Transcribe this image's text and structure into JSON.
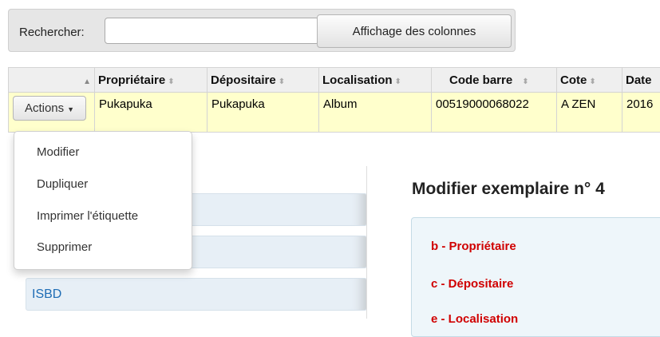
{
  "search": {
    "label": "Rechercher:",
    "value": "",
    "placeholder": ""
  },
  "toolbar": {
    "columns_button": "Affichage des colonnes"
  },
  "table": {
    "headers": [
      "Propriétaire",
      "Dépositaire",
      "Localisation",
      "Code barre",
      "Cote",
      "Date"
    ],
    "row": {
      "actions_label": "Actions",
      "cells": [
        "Pukapuka",
        "Pukapuka",
        "Album",
        "00519000068022",
        "A ZEN",
        "2016"
      ]
    }
  },
  "actions_menu": {
    "items": [
      "Modifier",
      "Dupliquer",
      "Imprimer l'étiquette",
      "Supprimer"
    ]
  },
  "sidebar": {
    "items": [
      {
        "label": ""
      },
      {
        "label": ""
      },
      {
        "label": "ISBD"
      }
    ]
  },
  "main": {
    "title": "Modifier exemplaire n° 4",
    "fields": [
      "b - Propriétaire",
      "c - Dépositaire",
      "e - Localisation"
    ]
  },
  "colors": {
    "field_label": "#d00000",
    "link": "#1e6db5",
    "row_highlight": "#ffffcc"
  }
}
